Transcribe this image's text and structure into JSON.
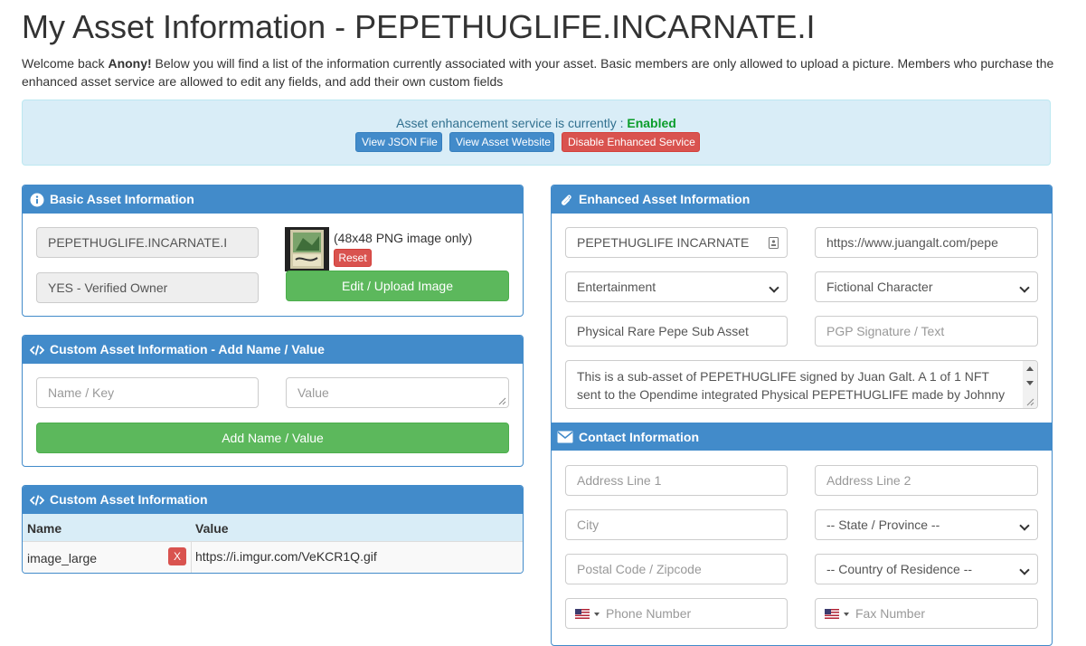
{
  "page": {
    "title": "My Asset Information - PEPETHUGLIFE.INCARNATE.I",
    "intro_prefix": "Welcome back ",
    "intro_user": "Anony!",
    "intro_text": " Below you will find a list of the information currently associated with your asset. Basic members are only allowed to upload a picture. Members who purchase the enhanced asset service are allowed to edit any fields, and add their own custom fields"
  },
  "alert": {
    "status_text": "Asset enhancement service is currently : ",
    "status_value": "Enabled",
    "buttons": [
      "View JSON File",
      "View Asset Website",
      "Disable Enhanced Service"
    ]
  },
  "basic": {
    "heading": "Basic Asset Information",
    "asset_name": "PEPETHUGLIFE.INCARNATE.I",
    "owner_status": "YES - Verified Owner",
    "image_hint": "(48x48 PNG image only)",
    "reset_label": "Reset",
    "upload_label": "Edit / Upload Image"
  },
  "custom_add": {
    "heading": "Custom Asset Information - Add Name / Value",
    "name_placeholder": "Name / Key",
    "value_placeholder": "Value",
    "add_label": "Add Name / Value"
  },
  "custom_list": {
    "heading": "Custom Asset Information",
    "columns": [
      "Name",
      "Value"
    ],
    "rows": [
      {
        "name": "image_large",
        "value": "https://i.imgur.com/VeKCR1Q.gif",
        "delete": "X"
      }
    ]
  },
  "enhanced": {
    "heading": "Enhanced Asset Information",
    "display_name": "PEPETHUGLIFE INCARNATE",
    "website": "https://www.juangalt.com/pepe",
    "category": "Entertainment",
    "subcategory": "Fictional Character",
    "short_description": "Physical Rare Pepe Sub Asset",
    "pgp_placeholder": "PGP Signature / Text",
    "description": "This is a sub-asset of PEPETHUGLIFE signed by Juan Galt. A 1 of 1 NFT sent to the Opendime integrated Physical PEPETHUGLIFE made by Johnny Bullo..."
  },
  "contact": {
    "heading": "Contact Information",
    "address1_placeholder": "Address Line 1",
    "address2_placeholder": "Address Line 2",
    "city_placeholder": "City",
    "state_selected": "-- State / Province --",
    "postal_placeholder": "Postal Code / Zipcode",
    "country_selected": "-- Country of Residence --",
    "phone_placeholder": "Phone Number",
    "fax_placeholder": "Fax Number"
  }
}
